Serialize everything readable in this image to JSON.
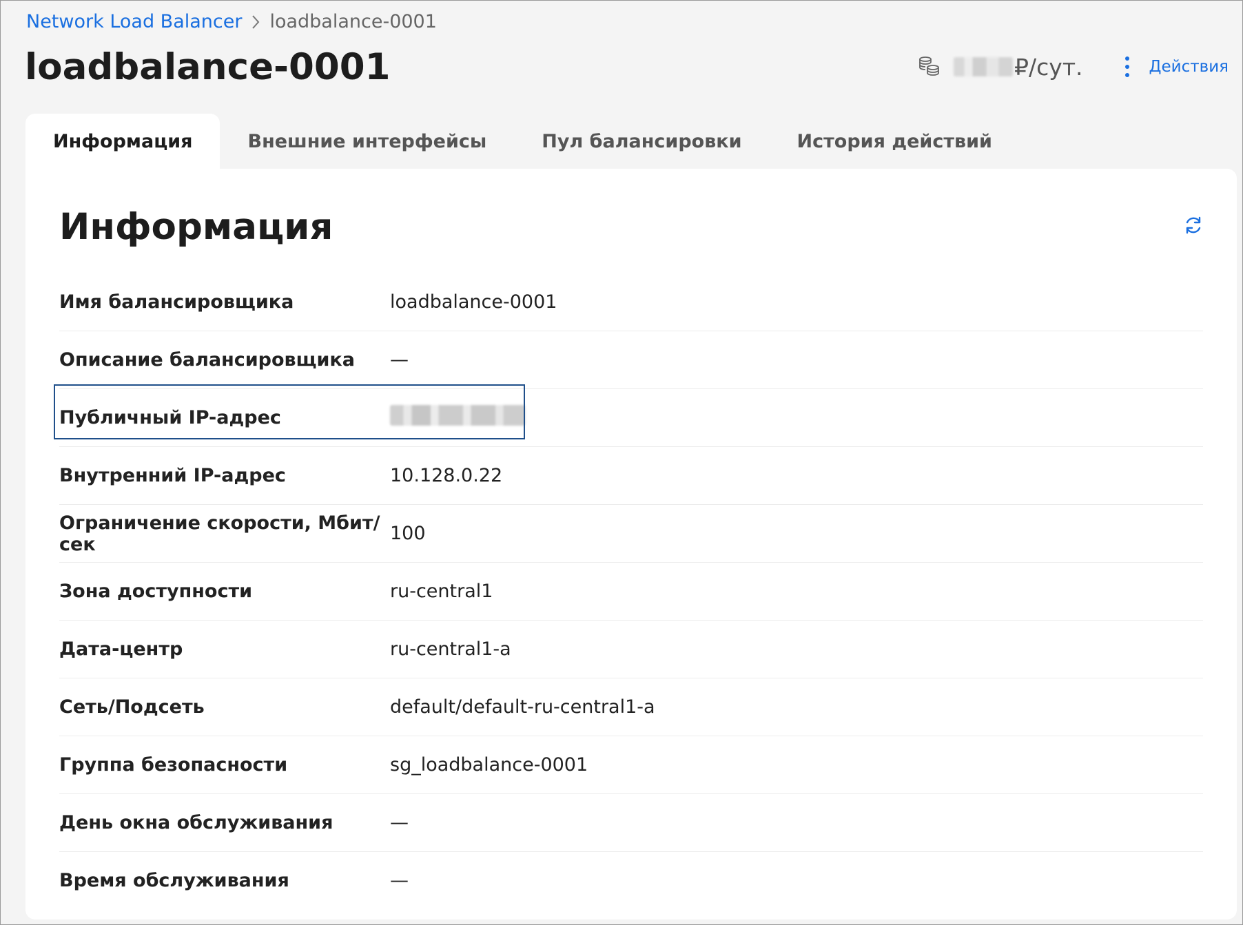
{
  "breadcrumb": {
    "parent": "Network Load Balancer",
    "current": "loadbalance-0001"
  },
  "header": {
    "title": "loadbalance-0001",
    "cost_unit": "₽/сут.",
    "actions_label": "Действия"
  },
  "tabs": [
    {
      "label": "Информация",
      "active": true
    },
    {
      "label": "Внешние интерфейсы",
      "active": false
    },
    {
      "label": "Пул балансировки",
      "active": false
    },
    {
      "label": "История действий",
      "active": false
    }
  ],
  "panel": {
    "title": "Информация",
    "rows": [
      {
        "label": "Имя балансировщика",
        "value": "loadbalance-0001"
      },
      {
        "label": "Описание балансировщика",
        "value": "—"
      },
      {
        "label": "Публичный IP-адрес",
        "value": ""
      },
      {
        "label": "Внутренний IP-адрес",
        "value": "10.128.0.22"
      },
      {
        "label": "Ограничение скорости, Мбит/сек",
        "value": "100"
      },
      {
        "label": "Зона доступности",
        "value": "ru-central1"
      },
      {
        "label": "Дата-центр",
        "value": "ru-central1-a"
      },
      {
        "label": "Сеть/Подсеть",
        "value": "default/default-ru-central1-a"
      },
      {
        "label": "Группа безопасности",
        "value": "sg_loadbalance-0001"
      },
      {
        "label": "День окна обслуживания",
        "value": "—"
      },
      {
        "label": "Время обслуживания",
        "value": "—"
      }
    ]
  },
  "colors": {
    "accent": "#1a6fe0",
    "highlight_border": "#1f4f8a"
  },
  "icons": {
    "breadcrumb_separator": "chevron-right-icon",
    "cost": "coins-icon",
    "menu": "kebab-icon",
    "refresh": "refresh-icon"
  }
}
